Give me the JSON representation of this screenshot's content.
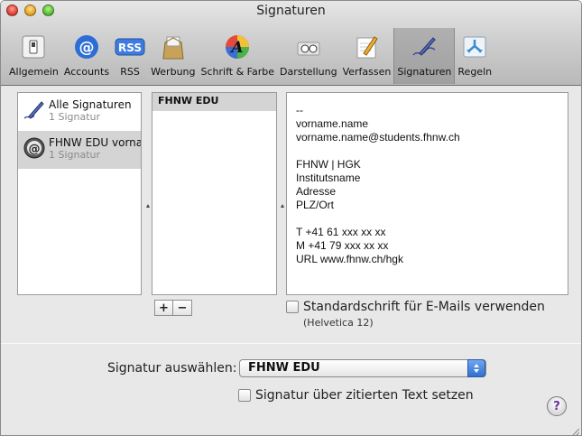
{
  "window": {
    "title": "Signaturen"
  },
  "toolbar": {
    "items": [
      {
        "label": "Allgemein",
        "icon": "switch-icon"
      },
      {
        "label": "Accounts",
        "icon": "at-icon"
      },
      {
        "label": "RSS",
        "icon": "rss-icon"
      },
      {
        "label": "Werbung",
        "icon": "junk-mail-icon"
      },
      {
        "label": "Schrift & Farbe",
        "icon": "font-color-icon"
      },
      {
        "label": "Darstellung",
        "icon": "glasses-icon"
      },
      {
        "label": "Verfassen",
        "icon": "compose-icon"
      },
      {
        "label": "Signaturen",
        "icon": "signature-icon"
      },
      {
        "label": "Regeln",
        "icon": "rules-icon"
      }
    ],
    "selected": "Signaturen"
  },
  "accounts": [
    {
      "name": "Alle Signaturen",
      "count": "1 Signatur",
      "icon": "pen-icon"
    },
    {
      "name": "FHNW EDU vorna",
      "count": "1 Signatur",
      "icon": "at-account-icon"
    }
  ],
  "signatures": [
    "FHNW EDU"
  ],
  "signature_text": [
    "--",
    "vorname.name",
    "vorname.name@students.fhnw.ch",
    "",
    "FHNW | HGK",
    "Institutsname",
    "Adresse",
    "PLZ/Ort",
    "",
    "T +41 61 xxx xx xx",
    "M +41 79 xxx xx xx",
    "URL www.fhnw.ch/hgk"
  ],
  "buttons": {
    "add": "+",
    "remove": "−"
  },
  "standard_font": {
    "label": "Standardschrift für E-Mails verwenden",
    "font": "(Helvetica 12)",
    "checked": false
  },
  "choose_signature": {
    "label": "Signatur auswählen:",
    "value": "FHNW EDU"
  },
  "above_quote": {
    "label": "Signatur über zitierten Text setzen",
    "checked": false
  },
  "help": "?"
}
